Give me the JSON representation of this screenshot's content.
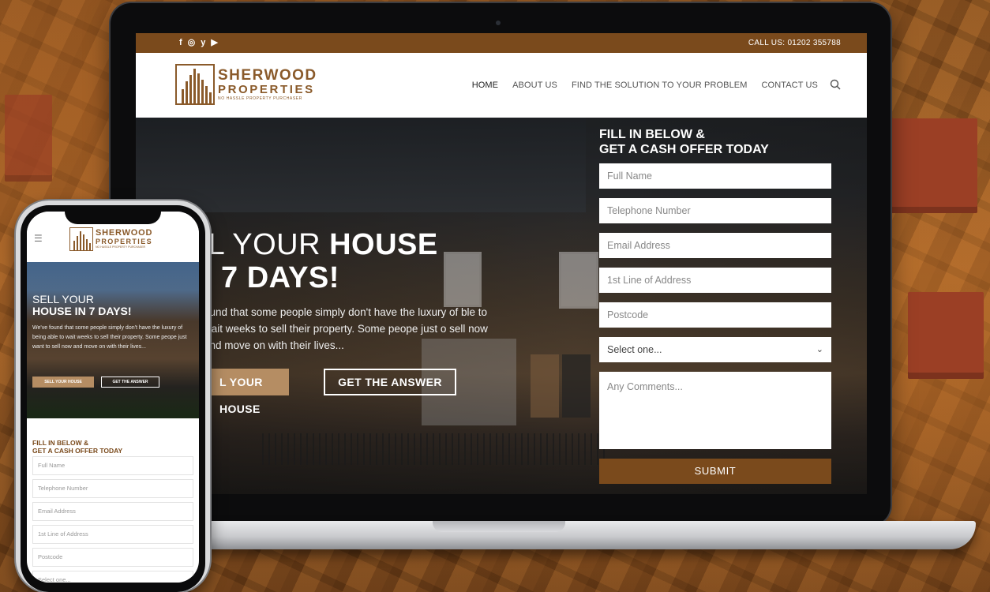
{
  "desktop": {
    "topbar": {
      "social": [
        "f",
        "◎",
        "y",
        "▶"
      ],
      "call": "CALL US: 01202 355788"
    },
    "logo": {
      "line1": "SHERWOOD",
      "line2": "PROPERTIES",
      "tagline": "NO HASSLE PROPERTY PURCHASER"
    },
    "nav": [
      "HOME",
      "ABOUT US",
      "FIND THE SOLUTION TO YOUR PROBLEM",
      "CONTACT US"
    ],
    "hero": {
      "title_part1": "LL YOUR ",
      "title_bold1": "HOUSE",
      "title_line2": "7 DAYS!",
      "copy": "ound that some people simply don't have the luxury of ble to wait weeks to sell their property. Some peope just o sell now and move on with their lives...",
      "btn_sell": "L YOUR HOUSE",
      "btn_answer": "GET THE ANSWER"
    },
    "form": {
      "title_line1": "FILL IN BELOW &",
      "title_line2": "GET A CASH OFFER TODAY",
      "fields": [
        "Full Name",
        "Telephone Number",
        "Email Address",
        "1st Line of Address",
        "Postcode"
      ],
      "select": "Select one...",
      "comments": "Any Comments...",
      "submit": "SUBMIT"
    }
  },
  "mobile": {
    "logo": {
      "line1": "SHERWOOD",
      "line2": "PROPERTIES",
      "tagline": "NO HASSLE PROPERTY PURCHASER"
    },
    "hero": {
      "title_line1": "SELL YOUR",
      "title_line2": "HOUSE IN 7 DAYS!",
      "copy": "We've found that some people simply don't have the luxury of being able to wait weeks to sell their property. Some peope just want to sell now and move on with their lives...",
      "btn_sell": "SELL YOUR HOUSE",
      "btn_answer": "GET THE ANSWER"
    },
    "form": {
      "title_line1": "FILL IN BELOW &",
      "title_line2": "GET A CASH OFFER TODAY",
      "fields": [
        "Full Name",
        "Telephone Number",
        "Email Address",
        "1st Line of Address",
        "Postcode"
      ],
      "partial_select": "Select one..."
    }
  },
  "colors": {
    "brand_brown": "#7a4a1c",
    "button_tan": "#b58d63",
    "logo_brown": "#8a5a2a"
  }
}
